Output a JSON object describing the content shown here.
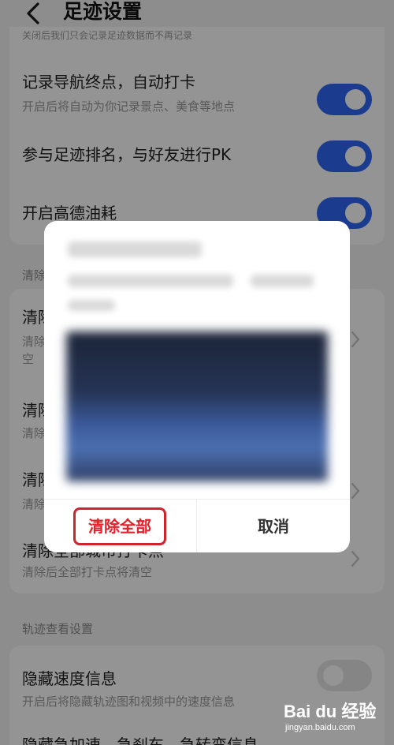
{
  "header": {
    "title": "足迹设置"
  },
  "card1": {
    "clipped_subtitle": "关闭后我们只会记录足迹数据而不再记录",
    "rows": [
      {
        "title": "记录导航终点，自动打卡",
        "subtitle": "开启后将自动为你记录景点、美食等地点",
        "toggle": "on"
      },
      {
        "title": "参与足迹排名，与好友进行PK",
        "toggle": "on"
      },
      {
        "title": "开启高德油耗",
        "toggle": "on"
      }
    ]
  },
  "section_clear": {
    "label_visible": "清除"
  },
  "card2": {
    "rows": [
      {
        "title_visible": "清除",
        "subtitle_visible": "清除",
        "subtitle_line2": "空"
      },
      {
        "title_visible": "清除",
        "subtitle_visible": "清除"
      },
      {
        "title_visible": "清除",
        "subtitle_visible": "清除"
      },
      {
        "title": "清除全部城市打卡点",
        "subtitle": "清除后全部打卡点将清空"
      }
    ]
  },
  "section_track": {
    "label": "轨迹查看设置"
  },
  "card3": {
    "rows": [
      {
        "title": "隐藏速度信息",
        "subtitle": "开启后将隐藏轨迹图和视频中的速度信息",
        "toggle": "off"
      },
      {
        "title": "隐藏急加速、急刹车、急转弯信息"
      }
    ]
  },
  "dialog": {
    "clear_all_label": "清除全部",
    "cancel_label": "取消"
  },
  "watermark": {
    "brand": "Bai du 经验",
    "url": "jingyan.baidu.com"
  },
  "colors": {
    "toggle_on": "#2f66f4",
    "toggle_off": "#e6e6e6",
    "highlight_red": "#d0242b"
  }
}
